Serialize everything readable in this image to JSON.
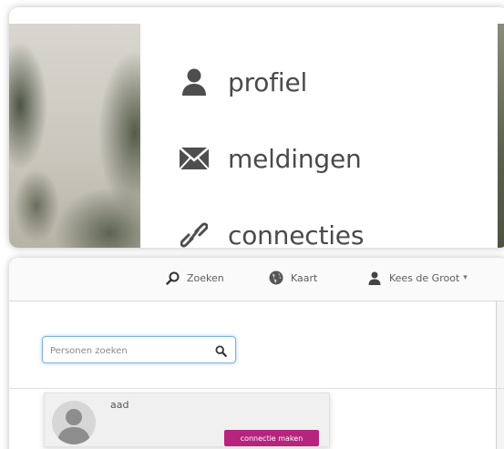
{
  "menu": {
    "items": [
      {
        "label": "profiel",
        "icon": "user-icon"
      },
      {
        "label": "meldingen",
        "icon": "envelope-icon"
      },
      {
        "label": "connecties",
        "icon": "link-icon"
      }
    ]
  },
  "navbar": {
    "search_label": "Zoeken",
    "map_label": "Kaart",
    "user_label": "Kees de Groot",
    "caret": "▾"
  },
  "search": {
    "placeholder": "Personen zoeken"
  },
  "results": [
    {
      "name": "aad",
      "action_label": "connectie maken"
    }
  ],
  "colors": {
    "accent": "#b5257e",
    "search_focus": "#7fb2e0",
    "icon_gray": "#4e4e4e"
  }
}
